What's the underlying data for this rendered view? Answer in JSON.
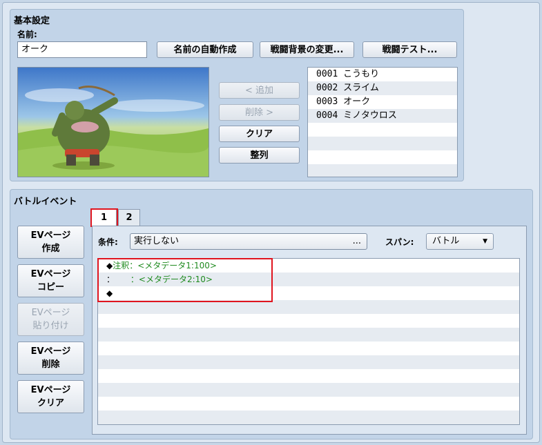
{
  "basic": {
    "title": "基本設定",
    "name_label": "名前:",
    "name_value": "オーク",
    "btn_auto_name": "名前の自動作成",
    "btn_change_bg": "戦闘背景の変更...",
    "btn_battle_test": "戦闘テスト...",
    "btn_add": "< 追加",
    "btn_remove": "削除 >",
    "btn_clear": "クリア",
    "btn_align": "整列",
    "enemies": [
      "0001 こうもり",
      "0002 スライム",
      "0003 オーク",
      "0004 ミノタウロス",
      "",
      "",
      "",
      ""
    ]
  },
  "battle_event": {
    "title": "バトルイベント",
    "tabs": [
      "1",
      "2"
    ],
    "ev_buttons": {
      "create": [
        "EVページ",
        "作成"
      ],
      "copy": [
        "EVページ",
        "コピー"
      ],
      "paste": [
        "EVページ",
        "貼り付け"
      ],
      "delete": [
        "EVページ",
        "削除"
      ],
      "clear": [
        "EVページ",
        "クリア"
      ]
    },
    "condition_label": "条件:",
    "condition_value": "実行しない",
    "condition_ellipsis": "...",
    "span_label": "スパン:",
    "span_value": "バトル",
    "commands": [
      {
        "prefix": "◆",
        "text": "注釈：<メタデータ1:100>"
      },
      {
        "prefix": "：",
        "text": "      ：<メタデータ2:10>"
      },
      {
        "prefix": "◆",
        "text": ""
      }
    ]
  },
  "colors": {
    "panel": "#c2d4e8",
    "comment_green": "#1f8a1f",
    "highlight_red": "#e0141e"
  }
}
